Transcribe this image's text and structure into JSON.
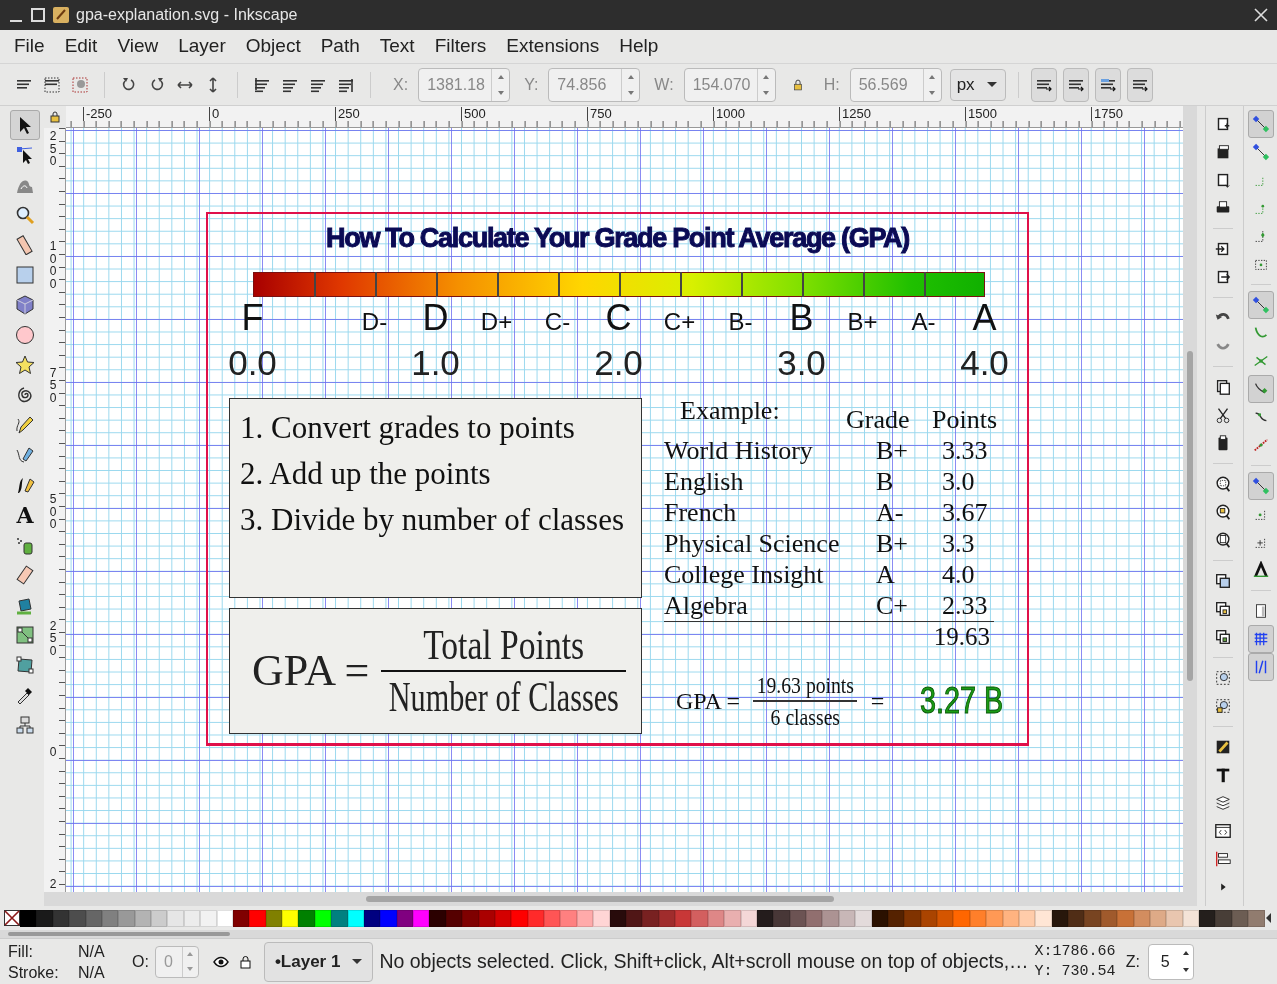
{
  "window": {
    "title": "gpa-explanation.svg - Inkscape"
  },
  "menu": [
    {
      "label": "File"
    },
    {
      "label": "Edit"
    },
    {
      "label": "View"
    },
    {
      "label": "Layer"
    },
    {
      "label": "Object"
    },
    {
      "label": "Path"
    },
    {
      "label": "Text"
    },
    {
      "label": "Filters"
    },
    {
      "label": "Extensions"
    },
    {
      "label": "Help"
    }
  ],
  "toolbar": {
    "fields": [
      {
        "label": "X:",
        "value": "1381.18"
      },
      {
        "label": "Y:",
        "value": "74.856"
      },
      {
        "label": "W:",
        "value": "154.070"
      },
      {
        "label": "H:",
        "value": "56.569"
      }
    ],
    "unit": "px"
  },
  "rulers": {
    "horizontal": [
      "-250",
      "0",
      "250",
      "500",
      "750",
      "1000",
      "1250",
      "1500",
      "1750"
    ],
    "vertical": [
      "250",
      "1000",
      "750",
      "500",
      "250",
      "0",
      "2"
    ]
  },
  "tools": [
    {
      "kind": "selector",
      "selected": true
    },
    {
      "kind": "node",
      "selected": false
    },
    {
      "kind": "tweak",
      "selected": false
    },
    {
      "kind": "zoom",
      "selected": false
    },
    {
      "kind": "measure",
      "selected": false
    },
    {
      "kind": "rect",
      "selected": false
    },
    {
      "kind": "box3d",
      "selected": false
    },
    {
      "kind": "ellipse",
      "selected": false
    },
    {
      "kind": "star",
      "selected": false
    },
    {
      "kind": "spiral",
      "selected": false
    },
    {
      "kind": "pencil",
      "selected": false
    },
    {
      "kind": "pen",
      "selected": false
    },
    {
      "kind": "calligraphy",
      "selected": false
    },
    {
      "kind": "text",
      "selected": false,
      "glyph": "A"
    },
    {
      "kind": "spray",
      "selected": false
    },
    {
      "kind": "eraser",
      "selected": false
    },
    {
      "kind": "bucket",
      "selected": false
    },
    {
      "kind": "gradient",
      "selected": false
    },
    {
      "kind": "mesh",
      "selected": false
    },
    {
      "kind": "dropper",
      "selected": false
    },
    {
      "kind": "connector",
      "selected": false
    }
  ],
  "snap": [
    {
      "on": true
    },
    {
      "on": false
    },
    {
      "on": false
    },
    {
      "on": false
    },
    {
      "on": false
    },
    {
      "on": false
    },
    {
      "on": true
    },
    {
      "on": false
    },
    {
      "on": false
    },
    {
      "on": true
    },
    {
      "on": false
    },
    {
      "on": false
    },
    {
      "on": true
    },
    {
      "on": false
    },
    {
      "on": false
    },
    {
      "on": false
    },
    {
      "on": false
    },
    {
      "on": true
    },
    {
      "on": true
    }
  ],
  "drawing": {
    "title": "How To Calculate Your Grade Point Average (GPA)",
    "grades": [
      {
        "label": "F",
        "kind": "major"
      },
      {
        "label": "D-",
        "kind": "minor"
      },
      {
        "label": "D",
        "kind": "major"
      },
      {
        "label": "D+",
        "kind": "minor"
      },
      {
        "label": "C-",
        "kind": "minor"
      },
      {
        "label": "C",
        "kind": "major"
      },
      {
        "label": "C+",
        "kind": "minor"
      },
      {
        "label": "B-",
        "kind": "minor"
      },
      {
        "label": "B",
        "kind": "major"
      },
      {
        "label": "B+",
        "kind": "minor"
      },
      {
        "label": "A-",
        "kind": "minor"
      },
      {
        "label": "A",
        "kind": "major"
      }
    ],
    "scale_numbers": [
      "0.0",
      "1.0",
      "2.0",
      "3.0",
      "4.0"
    ],
    "steps": [
      "1. Convert grades to points",
      "2. Add up the points",
      "3. Divide by number of classes"
    ],
    "formula": {
      "lhs": "GPA =",
      "numerator": "Total Points",
      "denominator": "Number of Classes"
    },
    "example": {
      "caption": "Example:",
      "columns": [
        "Grade",
        "Points"
      ],
      "rows": [
        {
          "subject": "World History",
          "grade": "B+",
          "points": "3.33"
        },
        {
          "subject": "English",
          "grade": "B",
          "points": "3.0"
        },
        {
          "subject": "French",
          "grade": "A-",
          "points": "3.67"
        },
        {
          "subject": "Physical Science",
          "grade": "B+",
          "points": "3.3"
        },
        {
          "subject": "College Insight",
          "grade": "A",
          "points": "4.0"
        },
        {
          "subject": "Algebra",
          "grade": "C+",
          "points": "2.33"
        }
      ],
      "total": "19.63",
      "gpa": {
        "lhs": "GPA =",
        "numerator": "19.63 points",
        "denominator": "6 classes",
        "equals": "=",
        "result": "3.27 B"
      }
    }
  },
  "palette": [
    {
      "color": "#000000"
    },
    {
      "color": "#1a1a1a"
    },
    {
      "color": "#333333"
    },
    {
      "color": "#4d4d4d"
    },
    {
      "color": "#666666"
    },
    {
      "color": "#808080"
    },
    {
      "color": "#999999"
    },
    {
      "color": "#b3b3b3"
    },
    {
      "color": "#cccccc"
    },
    {
      "color": "#e6e6e6"
    },
    {
      "color": "#ececec"
    },
    {
      "color": "#f2f2f2"
    },
    {
      "color": "#ffffff"
    },
    {
      "color": "#800000"
    },
    {
      "color": "#ff0000"
    },
    {
      "color": "#808000"
    },
    {
      "color": "#ffff00"
    },
    {
      "color": "#008000"
    },
    {
      "color": "#00ff00"
    },
    {
      "color": "#008080"
    },
    {
      "color": "#00ffff"
    },
    {
      "color": "#000080"
    },
    {
      "color": "#0000ff"
    },
    {
      "color": "#800080"
    },
    {
      "color": "#ff00ff"
    },
    {
      "color": "#2b0000"
    },
    {
      "color": "#550000"
    },
    {
      "color": "#7f0000"
    },
    {
      "color": "#aa0000"
    },
    {
      "color": "#d40000"
    },
    {
      "color": "#fe0000"
    },
    {
      "color": "#ff2a2a"
    },
    {
      "color": "#ff5555"
    },
    {
      "color": "#ff8080"
    },
    {
      "color": "#ffaaaa"
    },
    {
      "color": "#ffd5d5"
    },
    {
      "color": "#280b0b"
    },
    {
      "color": "#501616"
    },
    {
      "color": "#782121"
    },
    {
      "color": "#a02c2c"
    },
    {
      "color": "#c83737"
    },
    {
      "color": "#d35f5f"
    },
    {
      "color": "#de8787"
    },
    {
      "color": "#e9afaf"
    },
    {
      "color": "#f4d7d7"
    },
    {
      "color": "#241c1c"
    },
    {
      "color": "#483737"
    },
    {
      "color": "#6c5353"
    },
    {
      "color": "#916f6f"
    },
    {
      "color": "#ac9393"
    },
    {
      "color": "#c8b7b7"
    },
    {
      "color": "#e3dbdb"
    },
    {
      "color": "#2b1100"
    },
    {
      "color": "#552200"
    },
    {
      "color": "#803300"
    },
    {
      "color": "#aa4400"
    },
    {
      "color": "#d45500"
    },
    {
      "color": "#ff6600"
    },
    {
      "color": "#ff7f2a"
    },
    {
      "color": "#ff9955"
    },
    {
      "color": "#ffb380"
    },
    {
      "color": "#ffccaa"
    },
    {
      "color": "#ffe6d5"
    },
    {
      "color": "#28170b"
    },
    {
      "color": "#502d16"
    },
    {
      "color": "#784421"
    },
    {
      "color": "#a05a2c"
    },
    {
      "color": "#c87137"
    },
    {
      "color": "#d38d5f"
    },
    {
      "color": "#deaa87"
    },
    {
      "color": "#e9c6af"
    },
    {
      "color": "#f4e3d7"
    },
    {
      "color": "#241f1c"
    },
    {
      "color": "#483e37"
    },
    {
      "color": "#6c5d53"
    },
    {
      "color": "#917c6f"
    }
  ],
  "status": {
    "fill_label": "Fill:",
    "fill_value": "N/A",
    "stroke_label": "Stroke:",
    "stroke_value": "N/A",
    "opacity_label": "O:",
    "opacity_value": "0",
    "layer": "•Layer 1",
    "message": "No objects selected. Click, Shift+click, Alt+scroll mouse on top of objects,…",
    "x": "X:1786.66",
    "y": "Y: 730.54",
    "zoom_label": "Z:",
    "zoom_value": "5"
  }
}
